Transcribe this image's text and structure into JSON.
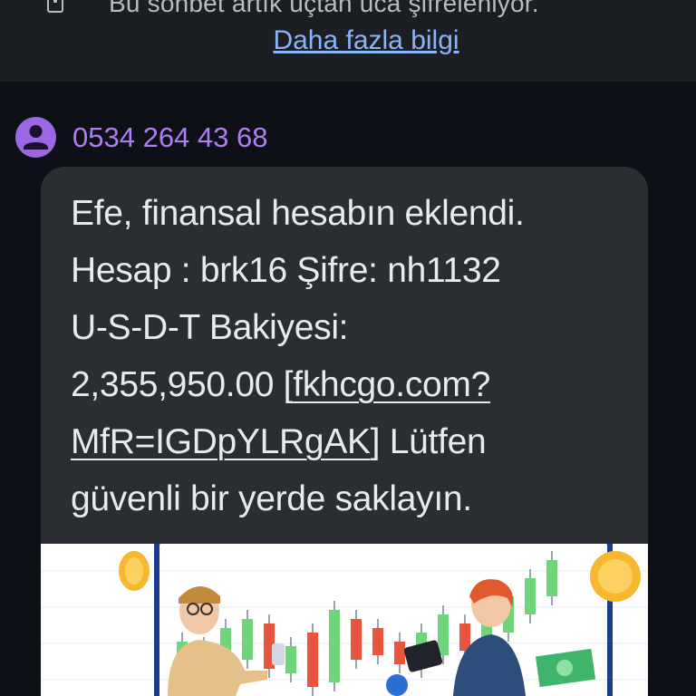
{
  "banner": {
    "icon": "lock-icon",
    "text": "Bu sohbet artık uçtan uca şifreleniyor.",
    "link": "Daha fazla bilgi"
  },
  "sender": {
    "icon": "person-avatar-icon",
    "phone": "0534 264 43 68",
    "color": "#b07cf2"
  },
  "message": {
    "line1": "Efe, finansal hesabın eklendi.",
    "line2": "Hesap : brk16 Şifre: nh1132",
    "line3": "U-S-D-T Bakiyesi:",
    "line4_prefix": "2,355,950.00 [",
    "link_part1": "fkhcgo.com?",
    "link_part2": "MfR=IGDpYLRgAK",
    "line5_suffix": "] Lütfen",
    "line6": "güvenli bir yerde saklayın."
  },
  "attachment": {
    "icon": "trading-chart-illustration",
    "colors": {
      "up": "#6fd47a",
      "down": "#e8553f",
      "coin": "#f5b82e"
    },
    "candles": [
      {
        "dir": "up",
        "open": 20,
        "close": 60
      },
      {
        "dir": "down",
        "open": 55,
        "close": 35
      },
      {
        "dir": "up",
        "open": 30,
        "close": 75
      },
      {
        "dir": "up",
        "open": 40,
        "close": 85
      },
      {
        "dir": "down",
        "open": 80,
        "close": 30
      },
      {
        "dir": "up",
        "open": 25,
        "close": 55
      },
      {
        "dir": "down",
        "open": 70,
        "close": 10
      },
      {
        "dir": "up",
        "open": 15,
        "close": 95
      },
      {
        "dir": "down",
        "open": 85,
        "close": 40
      },
      {
        "dir": "down",
        "open": 75,
        "close": 45
      },
      {
        "dir": "down",
        "open": 60,
        "close": 35
      },
      {
        "dir": "up",
        "open": 30,
        "close": 70
      },
      {
        "dir": "up",
        "open": 45,
        "close": 90
      },
      {
        "dir": "down",
        "open": 80,
        "close": 50
      },
      {
        "dir": "up",
        "open": 55,
        "close": 95
      },
      {
        "dir": "up",
        "open": 70,
        "close": 110
      },
      {
        "dir": "up",
        "open": 90,
        "close": 130
      },
      {
        "dir": "up",
        "open": 110,
        "close": 150
      }
    ]
  }
}
